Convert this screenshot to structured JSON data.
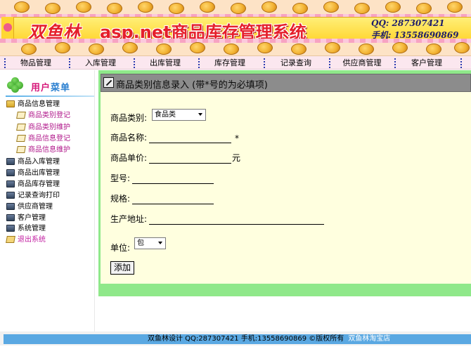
{
  "banner": {
    "brand": "双鱼林",
    "title": "asp.net商品库存管理系统",
    "qq": "QQ: 287307421",
    "phone": "手机: 13558690869"
  },
  "nav": {
    "items": [
      {
        "label": "物品管理"
      },
      {
        "label": "入库管理"
      },
      {
        "label": "出库管理"
      },
      {
        "label": "库存管理"
      },
      {
        "label": "记录查询"
      },
      {
        "label": "供应商管理"
      },
      {
        "label": "客户管理"
      }
    ]
  },
  "sidebar": {
    "title_part1": "用户",
    "title_part2": "菜单",
    "items": [
      {
        "label": "商品信息管理"
      },
      {
        "label": "商品类别登记"
      },
      {
        "label": "商品类别维护"
      },
      {
        "label": "商品信息登记"
      },
      {
        "label": "商品信息维护"
      },
      {
        "label": "商品入库管理"
      },
      {
        "label": "商品出库管理"
      },
      {
        "label": "商品库存管理"
      },
      {
        "label": "记录查询打印"
      },
      {
        "label": "供应商管理"
      },
      {
        "label": "客户管理"
      },
      {
        "label": "系统管理"
      },
      {
        "label": "退出系统"
      }
    ]
  },
  "panel": {
    "title": "商品类别信息录入 (带*号的为必填项)"
  },
  "form": {
    "category_label": "商品类别:",
    "category_value": "食品类",
    "name_label": "商品名称:",
    "name_required": "*",
    "price_label": "商品单价:",
    "price_unit": "元",
    "model_label": "型号:",
    "spec_label": "规格:",
    "origin_label": "生产地址:",
    "unit_label": "单位:",
    "unit_value": "包",
    "submit_label": "添加"
  },
  "footer": {
    "text": "双鱼林设计  QQ:287307421 手机:13558690869 ©版权所有",
    "link": "双鱼林淘宝店"
  },
  "colors": {
    "banner_title": "#e51f2b",
    "main_frame": "#8fe88a",
    "form_bg": "#ffffdf",
    "header_bg": "#8c8c8c",
    "footer_bar": "#5aa8e2",
    "sub_link": "#b0178a"
  }
}
